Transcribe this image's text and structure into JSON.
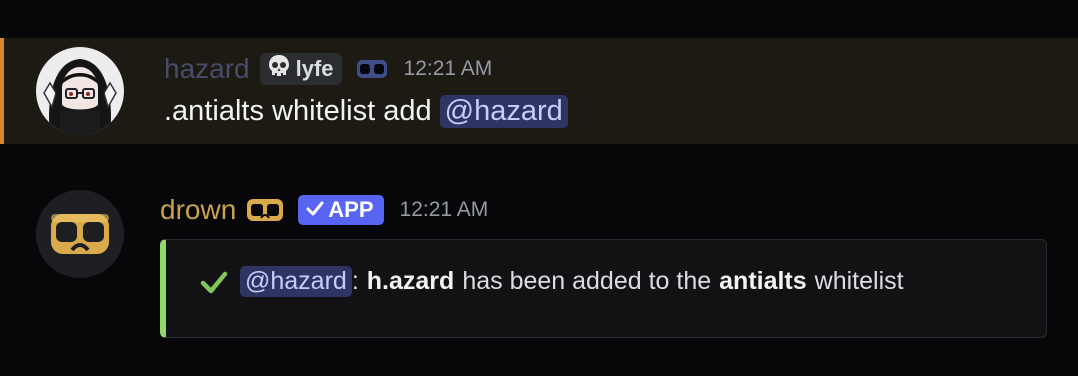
{
  "messages": [
    {
      "username": "hazard",
      "tag_label": "lyfe",
      "tag_icon": "skull-icon",
      "status_icon": "goggles-icon",
      "timestamp": "12:21 AM",
      "content_text": ".antialts whitelist add ",
      "content_mention": "@hazard",
      "highlight_color": "#d48a2c"
    },
    {
      "username": "drown",
      "badge_label": "APP",
      "timestamp": "12:21 AM",
      "embed": {
        "color": "#91d96c",
        "mention": "@hazard",
        "separator": ":",
        "bold_user": "h.azard",
        "middle_text": "has been added to the",
        "bold_feature": "antialts",
        "end_text": "whitelist"
      }
    }
  ]
}
